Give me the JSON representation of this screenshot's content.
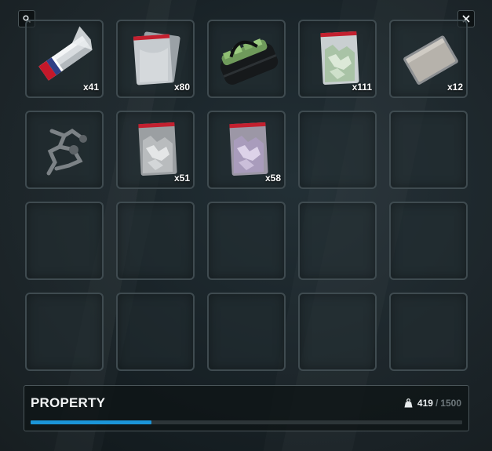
{
  "colors": {
    "accent": "#1b95d8"
  },
  "toolbar": {
    "search_icon": "search-icon",
    "close_icon": "close-icon"
  },
  "slots": [
    {
      "item": "foil-pack",
      "icon": "foil-pack-icon",
      "qty": "x41"
    },
    {
      "item": "empty-baggies",
      "icon": "baggie-stack-icon",
      "qty": "x80"
    },
    {
      "item": "cash-duffel-bag",
      "icon": "cash-bag-icon",
      "qty": ""
    },
    {
      "item": "green-crystal-bag",
      "icon": "green-bag-icon",
      "qty": "x111"
    },
    {
      "item": "metal-tray",
      "icon": "tray-icon",
      "qty": "x12"
    },
    {
      "item": "glass-pipe-apparatus",
      "icon": "pipe-icon",
      "qty": ""
    },
    {
      "item": "white-crystal-bag",
      "icon": "white-bag-icon",
      "qty": "x51"
    },
    {
      "item": "purple-crystal-bag",
      "icon": "purple-bag-icon",
      "qty": "x58"
    }
  ],
  "panel": {
    "title": "PROPERTY",
    "weight_icon": "weight-icon",
    "weight_current": "419",
    "weight_separator": "/",
    "weight_max": "1500",
    "weight_fraction": 0.2793
  }
}
